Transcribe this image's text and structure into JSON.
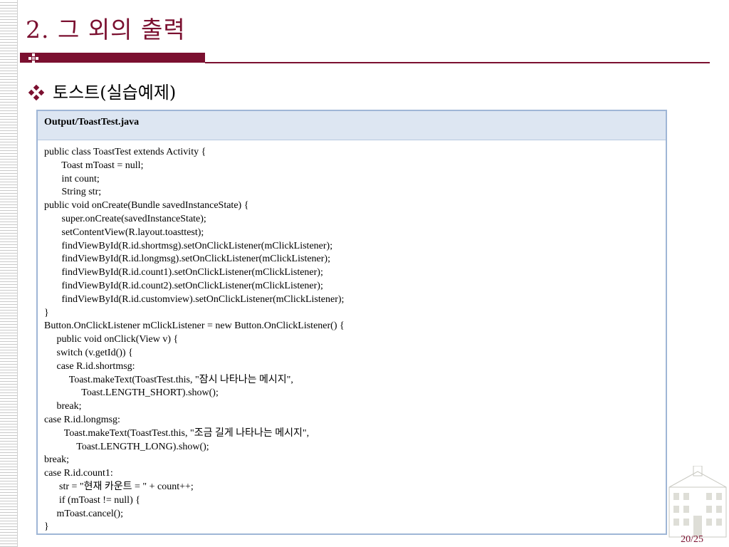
{
  "slide": {
    "title": "2. 그 외의 출력",
    "bullet_text": "토스트(실습예제)",
    "page_number": "20/25"
  },
  "code_box": {
    "header": "Output/ToastTest.java",
    "lines": [
      "public class ToastTest extends Activity {",
      "       Toast mToast = null;",
      "       int count;",
      "       String str;",
      "public void onCreate(Bundle savedInstanceState) {",
      "       super.onCreate(savedInstanceState);",
      "       setContentView(R.layout.toasttest);",
      "       findViewById(R.id.shortmsg).setOnClickListener(mClickListener);",
      "       findViewById(R.id.longmsg).setOnClickListener(mClickListener);",
      "       findViewById(R.id.count1).setOnClickListener(mClickListener);",
      "       findViewById(R.id.count2).setOnClickListener(mClickListener);",
      "       findViewById(R.id.customview).setOnClickListener(mClickListener);",
      "}",
      "Button.OnClickListener mClickListener = new Button.OnClickListener() {",
      "     public void onClick(View v) {",
      "     switch (v.getId()) {",
      "     case R.id.shortmsg:",
      "          Toast.makeText(ToastTest.this, \"잠시 나타나는 메시지\",",
      "               Toast.LENGTH_SHORT).show();",
      "     break;",
      "case R.id.longmsg:",
      "        Toast.makeText(ToastTest.this, \"조금 길게 나타나는 메시지\",",
      "             Toast.LENGTH_LONG).show();",
      "break;",
      "case R.id.count1:",
      "      str = \"현재 카운트 = \" + count++;",
      "      if (mToast != null) {",
      "     mToast.cancel();",
      "}"
    ]
  },
  "colors": {
    "accent": "#7b1030",
    "code_border": "#9fb6d6",
    "code_header_bg": "#dde6f2"
  },
  "icons": {
    "bullet": "diamond-bullet-icon",
    "title_mark": "checker-mark-icon"
  }
}
